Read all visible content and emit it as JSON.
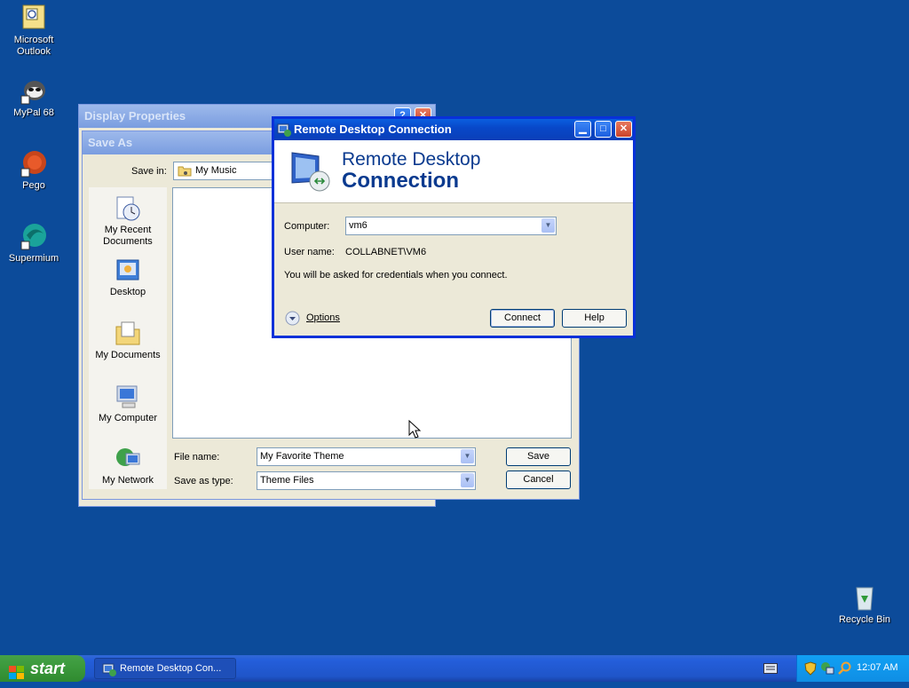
{
  "desktop_icons": [
    {
      "label": "Microsoft Outlook",
      "icon": "outlook-icon"
    },
    {
      "label": "MyPal 68",
      "icon": "mypal-icon"
    },
    {
      "label": "Pego",
      "icon": "pego-icon"
    },
    {
      "label": "Supermium",
      "icon": "supermium-icon"
    },
    {
      "label": "Recycle Bin",
      "icon": "recycle-bin-icon"
    }
  ],
  "display_properties": {
    "title": "Display Properties"
  },
  "save_as": {
    "title": "Save As",
    "save_in_label": "Save in:",
    "save_in_value": "My Music",
    "places": [
      "My Recent Documents",
      "Desktop",
      "My Documents",
      "My Computer",
      "My Network"
    ],
    "file_name_label": "File name:",
    "file_name_value": "My Favorite Theme",
    "save_type_label": "Save as type:",
    "save_type_value": "Theme Files",
    "save_button": "Save",
    "cancel_button": "Cancel"
  },
  "rdc": {
    "title": "Remote Desktop Connection",
    "banner_line1": "Remote Desktop",
    "banner_line2": "Connection",
    "computer_label": "Computer:",
    "computer_value": "vm6",
    "user_label": "User name:",
    "user_value": "COLLABNET\\VM6",
    "note": "You will be asked for credentials when you connect.",
    "options": "Options",
    "connect_button": "Connect",
    "help_button": "Help"
  },
  "taskbar": {
    "start_label": "start",
    "task_label": "Remote Desktop Con...",
    "clock": "12:07 AM"
  },
  "colors": {
    "desktop": "#0c4b9a",
    "titlebar": "#0a5fe0",
    "dialog": "#ece9d8"
  }
}
